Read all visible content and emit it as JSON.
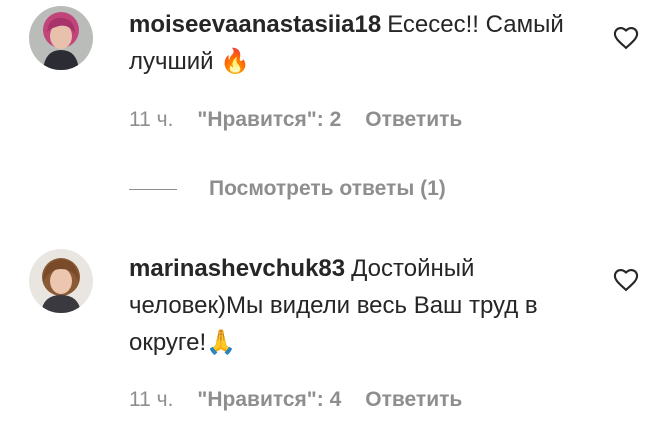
{
  "comments": [
    {
      "username": "moiseevaanastasiia18",
      "text": "Есесес!! Самый лучший",
      "emoji": "🔥",
      "time": "11 ч.",
      "likes": "\"Нравится\": 2",
      "reply": "Ответить",
      "avatar_icon": "user-avatar-pink-hair"
    },
    {
      "username": "marinashevchuk83",
      "text": "Достойный человек)Мы видели весь Ваш труд в округе!",
      "emoji": "🙏",
      "time": "11 ч.",
      "likes": "\"Нравится\": 4",
      "reply": "Ответить",
      "avatar_icon": "user-avatar-brown-hair"
    }
  ],
  "view_replies": "Посмотреть ответы (1)",
  "icons": {
    "like": "heart-icon"
  },
  "colors": {
    "text": "#262626",
    "secondary": "#8e8e8e",
    "background": "#ffffff"
  }
}
